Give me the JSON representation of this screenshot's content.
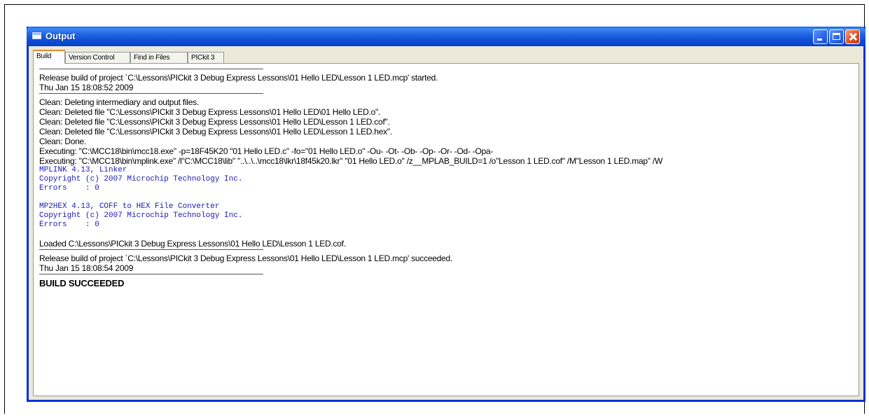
{
  "window": {
    "title": "Output"
  },
  "tabs": [
    {
      "label": "Build",
      "active": true
    },
    {
      "label": "Version Control",
      "active": false
    },
    {
      "label": "Find in Files",
      "active": false
    },
    {
      "label": "PICkit 3",
      "active": false
    }
  ],
  "output": {
    "start_line": "Release build of project `C:\\Lessons\\PICkit 3 Debug Express Lessons\\01 Hello LED\\Lesson 1 LED.mcp' started.",
    "start_time": "Thu Jan 15 18:08:52 2009",
    "clean_lines": [
      "Clean: Deleting intermediary and output files.",
      "Clean: Deleted file \"C:\\Lessons\\PICkit 3 Debug Express Lessons\\01 Hello LED\\01 Hello LED.o\".",
      "Clean: Deleted file \"C:\\Lessons\\PICkit 3 Debug Express Lessons\\01 Hello LED\\Lesson 1 LED.cof\".",
      "Clean: Deleted file \"C:\\Lessons\\PICkit 3 Debug Express Lessons\\01 Hello LED\\Lesson 1 LED.hex\".",
      "Clean: Done."
    ],
    "exec_lines": [
      "Executing: \"C:\\MCC18\\bin\\mcc18.exe\" -p=18F45K20 \"01 Hello LED.c\" -fo=\"01 Hello LED.o\" -Ou- -Ot- -Ob- -Op- -Or- -Od- -Opa-",
      "Executing: \"C:\\MCC18\\bin\\mplink.exe\" /l\"C:\\MCC18\\lib\" \"..\\..\\..\\mcc18\\lkr\\18f45k20.lkr\" \"01 Hello LED.o\" /z__MPLAB_BUILD=1 /o\"Lesson 1 LED.cof\" /M\"Lesson 1 LED.map\" /W"
    ],
    "mplink_lines": [
      "MPLINK 4.13, Linker",
      "Copyright (c) 2007 Microchip Technology Inc.",
      "Errors    : 0"
    ],
    "mp2hex_lines": [
      "MP2HEX 4.13, COFF to HEX File Converter",
      "Copyright (c) 2007 Microchip Technology Inc.",
      "Errors    : 0"
    ],
    "loaded_line": "Loaded C:\\Lessons\\PICkit 3 Debug Express Lessons\\01 Hello LED\\Lesson 1 LED.cof.",
    "end_line": "Release build of project `C:\\Lessons\\PICkit 3 Debug Express Lessons\\01 Hello LED\\Lesson 1 LED.mcp' succeeded.",
    "end_time": "Thu Jan 15 18:08:54 2009",
    "result": "BUILD SUCCEEDED"
  },
  "colors": {
    "titlebar": "#0a4fd6",
    "tool_output": "#1a1ab4"
  },
  "icons": {
    "title": "window-icon",
    "minimize": "minimize-icon",
    "maximize": "maximize-icon",
    "close": "close-icon"
  }
}
